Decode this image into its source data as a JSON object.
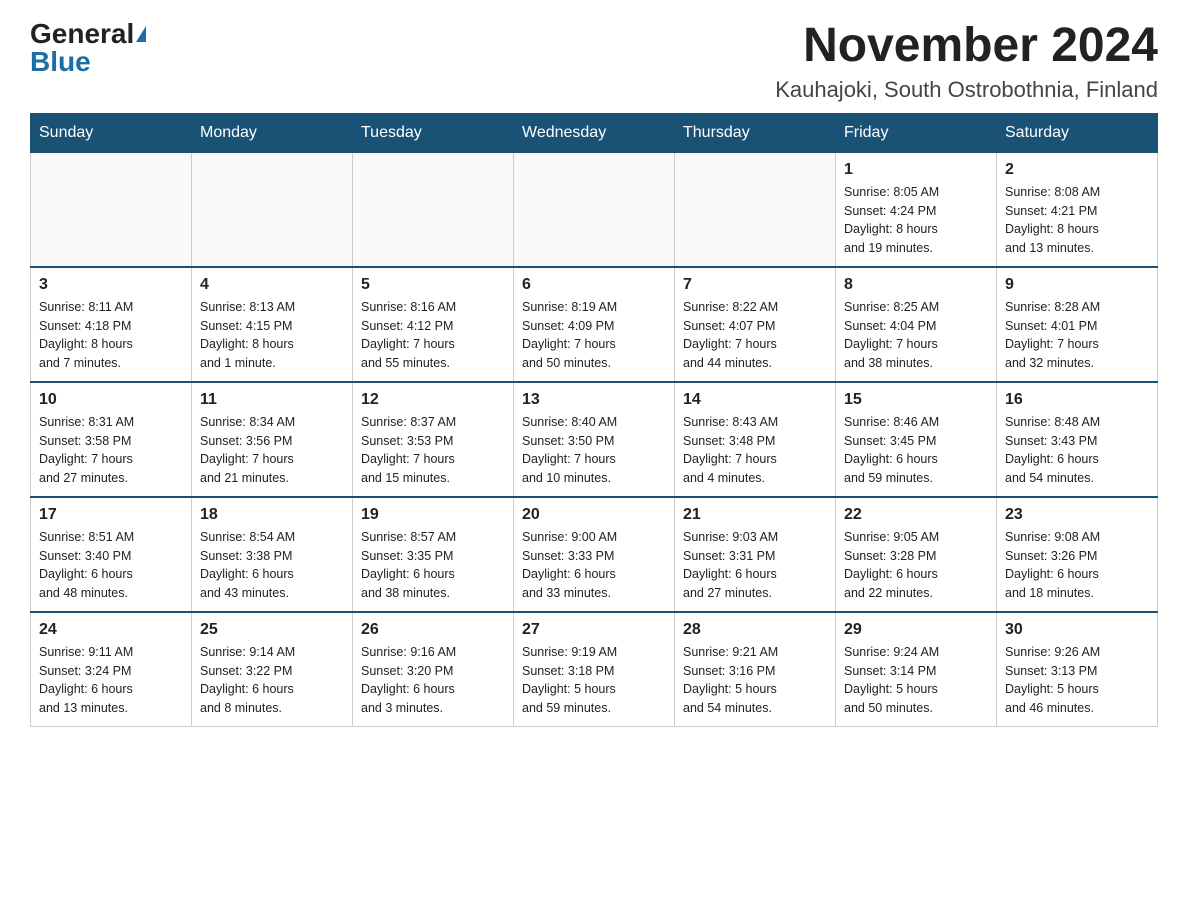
{
  "header": {
    "logo_general": "General",
    "logo_blue": "Blue",
    "month_title": "November 2024",
    "location": "Kauhajoki, South Ostrobothnia, Finland"
  },
  "days_of_week": [
    "Sunday",
    "Monday",
    "Tuesday",
    "Wednesday",
    "Thursday",
    "Friday",
    "Saturday"
  ],
  "weeks": [
    [
      {
        "day": "",
        "info": ""
      },
      {
        "day": "",
        "info": ""
      },
      {
        "day": "",
        "info": ""
      },
      {
        "day": "",
        "info": ""
      },
      {
        "day": "",
        "info": ""
      },
      {
        "day": "1",
        "info": "Sunrise: 8:05 AM\nSunset: 4:24 PM\nDaylight: 8 hours\nand 19 minutes."
      },
      {
        "day": "2",
        "info": "Sunrise: 8:08 AM\nSunset: 4:21 PM\nDaylight: 8 hours\nand 13 minutes."
      }
    ],
    [
      {
        "day": "3",
        "info": "Sunrise: 8:11 AM\nSunset: 4:18 PM\nDaylight: 8 hours\nand 7 minutes."
      },
      {
        "day": "4",
        "info": "Sunrise: 8:13 AM\nSunset: 4:15 PM\nDaylight: 8 hours\nand 1 minute."
      },
      {
        "day": "5",
        "info": "Sunrise: 8:16 AM\nSunset: 4:12 PM\nDaylight: 7 hours\nand 55 minutes."
      },
      {
        "day": "6",
        "info": "Sunrise: 8:19 AM\nSunset: 4:09 PM\nDaylight: 7 hours\nand 50 minutes."
      },
      {
        "day": "7",
        "info": "Sunrise: 8:22 AM\nSunset: 4:07 PM\nDaylight: 7 hours\nand 44 minutes."
      },
      {
        "day": "8",
        "info": "Sunrise: 8:25 AM\nSunset: 4:04 PM\nDaylight: 7 hours\nand 38 minutes."
      },
      {
        "day": "9",
        "info": "Sunrise: 8:28 AM\nSunset: 4:01 PM\nDaylight: 7 hours\nand 32 minutes."
      }
    ],
    [
      {
        "day": "10",
        "info": "Sunrise: 8:31 AM\nSunset: 3:58 PM\nDaylight: 7 hours\nand 27 minutes."
      },
      {
        "day": "11",
        "info": "Sunrise: 8:34 AM\nSunset: 3:56 PM\nDaylight: 7 hours\nand 21 minutes."
      },
      {
        "day": "12",
        "info": "Sunrise: 8:37 AM\nSunset: 3:53 PM\nDaylight: 7 hours\nand 15 minutes."
      },
      {
        "day": "13",
        "info": "Sunrise: 8:40 AM\nSunset: 3:50 PM\nDaylight: 7 hours\nand 10 minutes."
      },
      {
        "day": "14",
        "info": "Sunrise: 8:43 AM\nSunset: 3:48 PM\nDaylight: 7 hours\nand 4 minutes."
      },
      {
        "day": "15",
        "info": "Sunrise: 8:46 AM\nSunset: 3:45 PM\nDaylight: 6 hours\nand 59 minutes."
      },
      {
        "day": "16",
        "info": "Sunrise: 8:48 AM\nSunset: 3:43 PM\nDaylight: 6 hours\nand 54 minutes."
      }
    ],
    [
      {
        "day": "17",
        "info": "Sunrise: 8:51 AM\nSunset: 3:40 PM\nDaylight: 6 hours\nand 48 minutes."
      },
      {
        "day": "18",
        "info": "Sunrise: 8:54 AM\nSunset: 3:38 PM\nDaylight: 6 hours\nand 43 minutes."
      },
      {
        "day": "19",
        "info": "Sunrise: 8:57 AM\nSunset: 3:35 PM\nDaylight: 6 hours\nand 38 minutes."
      },
      {
        "day": "20",
        "info": "Sunrise: 9:00 AM\nSunset: 3:33 PM\nDaylight: 6 hours\nand 33 minutes."
      },
      {
        "day": "21",
        "info": "Sunrise: 9:03 AM\nSunset: 3:31 PM\nDaylight: 6 hours\nand 27 minutes."
      },
      {
        "day": "22",
        "info": "Sunrise: 9:05 AM\nSunset: 3:28 PM\nDaylight: 6 hours\nand 22 minutes."
      },
      {
        "day": "23",
        "info": "Sunrise: 9:08 AM\nSunset: 3:26 PM\nDaylight: 6 hours\nand 18 minutes."
      }
    ],
    [
      {
        "day": "24",
        "info": "Sunrise: 9:11 AM\nSunset: 3:24 PM\nDaylight: 6 hours\nand 13 minutes."
      },
      {
        "day": "25",
        "info": "Sunrise: 9:14 AM\nSunset: 3:22 PM\nDaylight: 6 hours\nand 8 minutes."
      },
      {
        "day": "26",
        "info": "Sunrise: 9:16 AM\nSunset: 3:20 PM\nDaylight: 6 hours\nand 3 minutes."
      },
      {
        "day": "27",
        "info": "Sunrise: 9:19 AM\nSunset: 3:18 PM\nDaylight: 5 hours\nand 59 minutes."
      },
      {
        "day": "28",
        "info": "Sunrise: 9:21 AM\nSunset: 3:16 PM\nDaylight: 5 hours\nand 54 minutes."
      },
      {
        "day": "29",
        "info": "Sunrise: 9:24 AM\nSunset: 3:14 PM\nDaylight: 5 hours\nand 50 minutes."
      },
      {
        "day": "30",
        "info": "Sunrise: 9:26 AM\nSunset: 3:13 PM\nDaylight: 5 hours\nand 46 minutes."
      }
    ]
  ]
}
